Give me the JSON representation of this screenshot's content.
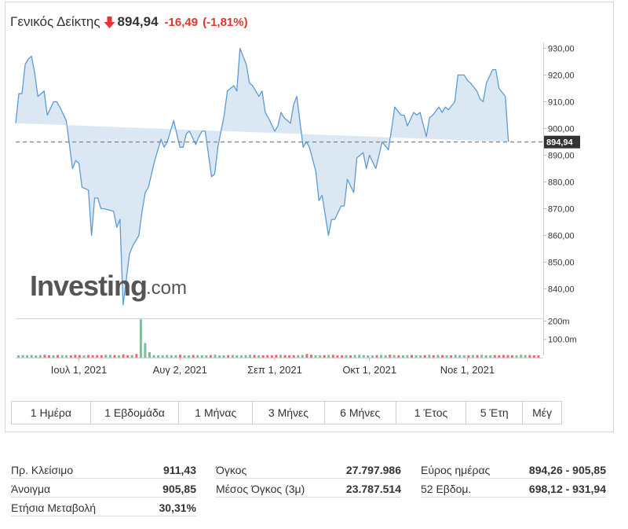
{
  "header": {
    "name": "Γενικός Δείκτης",
    "price": "894,94",
    "change": "-16,49",
    "change_pct": "(-1,81%)",
    "direction_icon": "down-arrow-icon",
    "down_color": "#e3342f"
  },
  "logo": {
    "brand": "Investing",
    "suffix": ".com"
  },
  "chart_data": {
    "type": "area",
    "y_axis": {
      "ticks": [
        840,
        850,
        860,
        870,
        880,
        890,
        900,
        910,
        920,
        930
      ],
      "tick_labels": [
        "840,00",
        "850,00",
        "860,00",
        "870,00",
        "880,00",
        "890,00",
        "900,00",
        "910,00",
        "920,00",
        "930,00"
      ],
      "range": [
        829,
        931
      ],
      "position": "right"
    },
    "x_axis": {
      "labels": [
        "Ιουλ 1, 2021",
        "Αυγ 2, 2021",
        "Σεπ 1, 2021",
        "Οκτ 1, 2021",
        "Νοε 1, 2021"
      ],
      "label_dates": [
        "2021-07-01",
        "2021-08-02",
        "2021-09-01",
        "2021-10-01",
        "2021-11-01"
      ],
      "range": [
        "2021-06-11",
        "2021-11-25"
      ]
    },
    "last_value": 894.94,
    "last_value_label": "894,94",
    "reference_line": 894.94,
    "series": {
      "dates": [
        "2021-06-11",
        "2021-06-12",
        "2021-06-13",
        "2021-06-14",
        "2021-06-15",
        "2021-06-16",
        "2021-06-17",
        "2021-06-18",
        "2021-06-20",
        "2021-06-21",
        "2021-06-23",
        "2021-06-24",
        "2021-06-25",
        "2021-06-27",
        "2021-06-29",
        "2021-06-30",
        "2021-07-01",
        "2021-07-02",
        "2021-07-04",
        "2021-07-05",
        "2021-07-06",
        "2021-07-07",
        "2021-07-08",
        "2021-07-09",
        "2021-07-12",
        "2021-07-13",
        "2021-07-14",
        "2021-07-15",
        "2021-07-17",
        "2021-07-18",
        "2021-07-20",
        "2021-07-21",
        "2021-07-22",
        "2021-07-23",
        "2021-07-24",
        "2021-07-25",
        "2021-07-27",
        "2021-07-28",
        "2021-07-29",
        "2021-07-31",
        "2021-08-02",
        "2021-08-03",
        "2021-08-04",
        "2021-08-05",
        "2021-08-07",
        "2021-08-08",
        "2021-08-09",
        "2021-08-10",
        "2021-08-12",
        "2021-08-13",
        "2021-08-14",
        "2021-08-16",
        "2021-08-17",
        "2021-08-19",
        "2021-08-20",
        "2021-08-21",
        "2021-08-23",
        "2021-08-24",
        "2021-08-25",
        "2021-08-27",
        "2021-08-28",
        "2021-08-29",
        "2021-08-30",
        "2021-09-01",
        "2021-09-02",
        "2021-09-03",
        "2021-09-04",
        "2021-09-06",
        "2021-09-07",
        "2021-09-08",
        "2021-09-10",
        "2021-09-11",
        "2021-09-12",
        "2021-09-14",
        "2021-09-15",
        "2021-09-16",
        "2021-09-18",
        "2021-09-19",
        "2021-09-20",
        "2021-09-22",
        "2021-09-23",
        "2021-09-24",
        "2021-09-26",
        "2021-09-27",
        "2021-09-29",
        "2021-09-30",
        "2021-10-01",
        "2021-10-03",
        "2021-10-04",
        "2021-10-05",
        "2021-10-07",
        "2021-10-08",
        "2021-10-09",
        "2021-10-11",
        "2021-10-12",
        "2021-10-13",
        "2021-10-15",
        "2021-10-16",
        "2021-10-17",
        "2021-10-19",
        "2021-10-20",
        "2021-10-21",
        "2021-10-23",
        "2021-10-24",
        "2021-10-25",
        "2021-10-26",
        "2021-10-28",
        "2021-10-29",
        "2021-10-31",
        "2021-11-01",
        "2021-11-02",
        "2021-11-04",
        "2021-11-05",
        "2021-11-06",
        "2021-11-07",
        "2021-11-09",
        "2021-11-10",
        "2021-11-11",
        "2021-11-13",
        "2021-11-14",
        "2021-11-15",
        "2021-11-17",
        "2021-11-18",
        "2021-11-19",
        "2021-11-21",
        "2021-11-22",
        "2021-11-23",
        "2021-11-24"
      ],
      "values": [
        902,
        913,
        913,
        924,
        926,
        927,
        921,
        912,
        914,
        905,
        910,
        910,
        908,
        903,
        885,
        888,
        887,
        878,
        877,
        860,
        874,
        874,
        870,
        870,
        869,
        863,
        866,
        834,
        853,
        856,
        860,
        869,
        876,
        878,
        883,
        888,
        896,
        893,
        895,
        903,
        893,
        893,
        898,
        899,
        894,
        897,
        899,
        899,
        882,
        883,
        893,
        905,
        914,
        916,
        914,
        930,
        924,
        917,
        916,
        912,
        914,
        906,
        904,
        899,
        901,
        906,
        904,
        902,
        909,
        912,
        893,
        895,
        893,
        884,
        873,
        875,
        860,
        866,
        866,
        871,
        871,
        881,
        876,
        889,
        891,
        885,
        890,
        885,
        890,
        895,
        892,
        900,
        908,
        905,
        905,
        901,
        906,
        905,
        906,
        897,
        904,
        905,
        908,
        906,
        908,
        907,
        910,
        920,
        920,
        918,
        917,
        914,
        911,
        910,
        917,
        922,
        922,
        915,
        912,
        895
      ]
    },
    "volume_axis": {
      "ticks": [
        100000000,
        200000000
      ],
      "tick_labels": [
        "100.0m",
        "200m"
      ],
      "range": [
        0,
        215000000
      ]
    },
    "volume": {
      "values": [
        12,
        14,
        13,
        15,
        12,
        14,
        16,
        13,
        12,
        15,
        14,
        13,
        12,
        16,
        14,
        13,
        15,
        12,
        14,
        13,
        16,
        15,
        14,
        13,
        18,
        12,
        14,
        20,
        210,
        80,
        30,
        14,
        13,
        12,
        15,
        14,
        13,
        16,
        12,
        13,
        15,
        14,
        12,
        13,
        14,
        16,
        13,
        12,
        14,
        15,
        13,
        12,
        14,
        16,
        15,
        13,
        12,
        14,
        13,
        15,
        16,
        14,
        12,
        13,
        14,
        15,
        20,
        16,
        13,
        12,
        14,
        15,
        16,
        13,
        12,
        14,
        13,
        15,
        16,
        14,
        12,
        13,
        14,
        15,
        13,
        16,
        14,
        12,
        13,
        14,
        15,
        13,
        12,
        14,
        16,
        13,
        15,
        14,
        12,
        13,
        16,
        14,
        13,
        12,
        15,
        14,
        16,
        13,
        12,
        14,
        13,
        15,
        14,
        12,
        13,
        16,
        14,
        15,
        13,
        12
      ],
      "colors_up": "#6ab187",
      "colors_down": "#e05555"
    },
    "grid": false
  },
  "range_buttons": [
    "1 Ημέρα",
    "1 Εβδομάδα",
    "1 Μήνας",
    "3 Μήνες",
    "6 Μήνες",
    "1 Έτος",
    "5 Έτη",
    "Μέγ"
  ],
  "stats": {
    "col1": [
      {
        "label": "Πρ. Κλείσιμο",
        "value": "911,43"
      },
      {
        "label": "Άνοιγμα",
        "value": "905,85"
      },
      {
        "label": "Ετήσια Μεταβολή",
        "value": "30,31%"
      }
    ],
    "col2": [
      {
        "label": "Όγκος",
        "value": "27.797.986"
      },
      {
        "label": "Μέσος Όγκος (3μ)",
        "value": "23.787.514"
      }
    ],
    "col3": [
      {
        "label": "Εύρος ημέρας",
        "value": "894,26 - 905,85"
      },
      {
        "label": "52 Εβδομ.",
        "value": "698,12 - 931,94"
      }
    ]
  },
  "colors": {
    "line": "#5b9bd5",
    "area": "#dbe8f4",
    "reference_line": "#777777",
    "last_value_bg": "#333333"
  }
}
